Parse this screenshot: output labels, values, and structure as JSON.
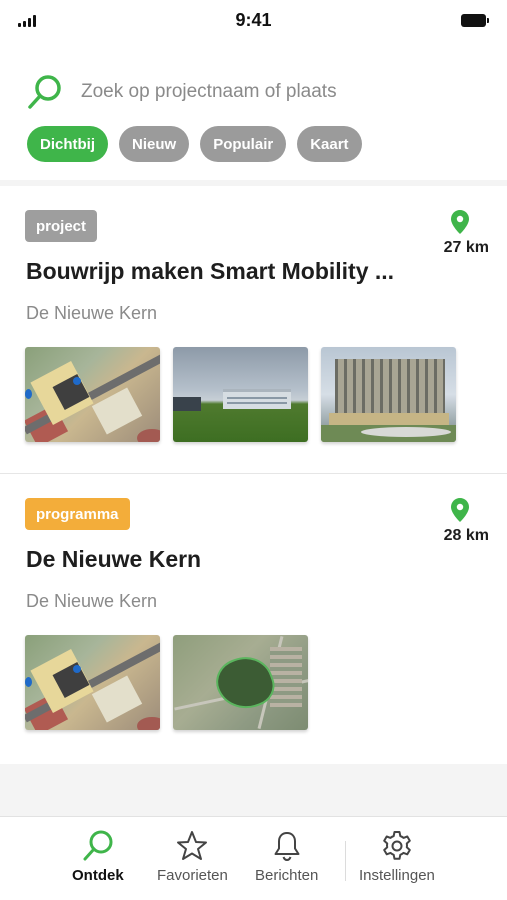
{
  "status": {
    "time": "9:41"
  },
  "search": {
    "placeholder": "Zoek op projectnaam of plaats"
  },
  "filters": [
    {
      "label": "Dichtbij",
      "active": true
    },
    {
      "label": "Nieuw",
      "active": false
    },
    {
      "label": "Populair",
      "active": false
    },
    {
      "label": "Kaart",
      "active": false
    }
  ],
  "colors": {
    "accent": "#3fb54a",
    "chip_inactive": "#9b9b9b",
    "tag_project": "#9e9e9e",
    "tag_programma": "#f3ad3a"
  },
  "cards": [
    {
      "tag": "project",
      "title": "Bouwrijp maken Smart Mobility ...",
      "location": "De Nieuwe Kern",
      "distance": "27 km",
      "icon": "map-pin-icon",
      "thumbnails": [
        "site-map-thumbnail",
        "green-field-photo-thumbnail",
        "office-building-photo-thumbnail"
      ]
    },
    {
      "tag": "programma",
      "title": "De Nieuwe Kern",
      "location": "De Nieuwe Kern",
      "distance": "28 km",
      "icon": "map-pin-icon",
      "thumbnails": [
        "site-map-thumbnail",
        "aerial-map-thumbnail"
      ]
    }
  ],
  "tabs": [
    {
      "label": "Ontdek",
      "icon": "search-icon",
      "active": true
    },
    {
      "label": "Favorieten",
      "icon": "star-icon",
      "active": false
    },
    {
      "label": "Berichten",
      "icon": "bell-icon",
      "active": false
    },
    {
      "label": "Instellingen",
      "icon": "gear-icon",
      "active": false
    }
  ]
}
